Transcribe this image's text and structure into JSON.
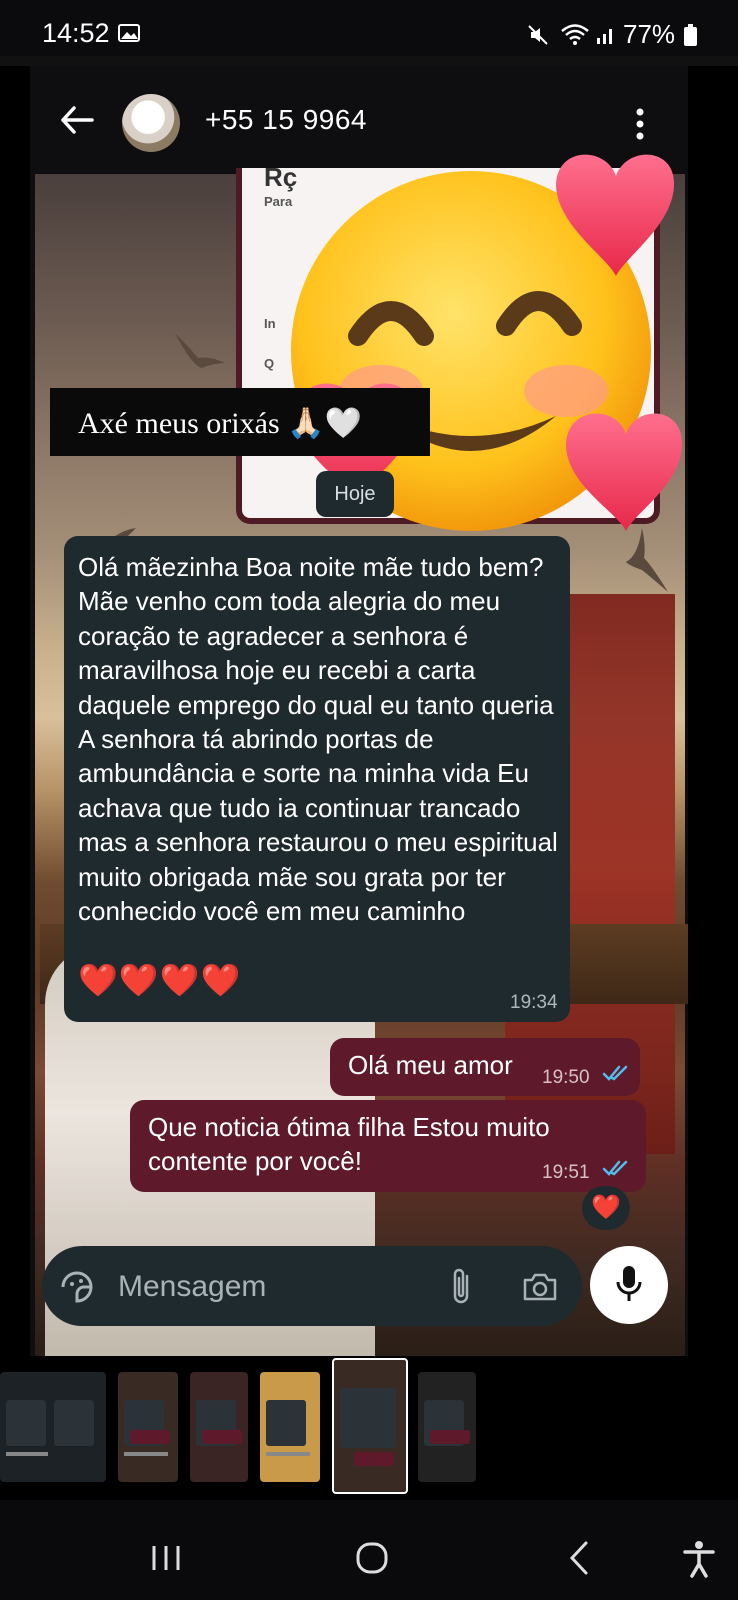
{
  "status_bar": {
    "time": "14:52",
    "battery": "77%"
  },
  "header": {
    "contact": "+55 15 9964"
  },
  "story": {
    "card_lines": [
      "Rç",
      "Para",
      "In",
      "Q"
    ],
    "caption": "Axé meus orixás 🙏🏻🤍"
  },
  "date_pill": "Hoje",
  "messages": {
    "incoming": {
      "text": "Olá mãezinha Boa noite mãe tudo bem? Mãe venho com toda alegria do meu coração te agradecer a senhora é maravilhosa hoje eu recebi a carta daquele emprego do qual eu tanto queria A senhora tá abrindo portas de ambundância e sorte na minha vida Eu achava que tudo ia continuar trancado mas a senhora restaurou o meu espiritual muito obrigada mãe sou grata por ter conhecido você em meu caminho",
      "emoji": "❤️❤️❤️❤️",
      "time": "19:34"
    },
    "outgoing": [
      {
        "text": "Olá meu amor",
        "time": "19:50"
      },
      {
        "text": "Que noticia ótima filha Estou muito contente por você!",
        "time": "19:51",
        "reaction": "❤️"
      }
    ]
  },
  "composer": {
    "placeholder": "Mensagem"
  },
  "colors": {
    "incoming_bubble": "#1f2a2f",
    "outgoing_bubble": "#5e1a2a",
    "read_ticks": "#53bdeb",
    "heart": "#e8284a"
  }
}
